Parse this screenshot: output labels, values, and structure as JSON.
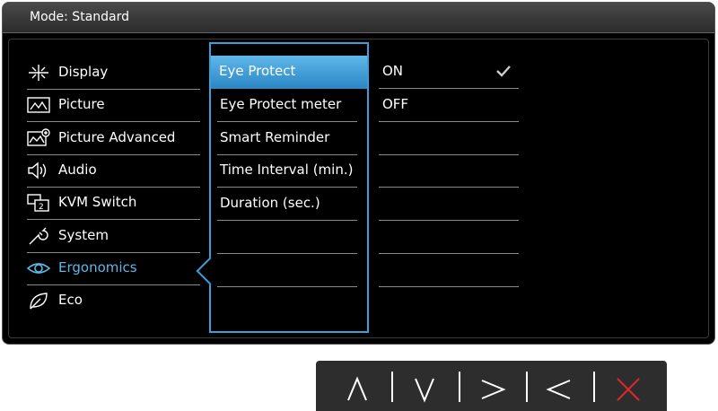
{
  "header": {
    "mode_label": "Mode: Standard"
  },
  "menu": [
    {
      "label": "Display",
      "icon": "display-icon"
    },
    {
      "label": "Picture",
      "icon": "picture-icon"
    },
    {
      "label": "Picture Advanced",
      "icon": "picture-advanced-icon"
    },
    {
      "label": "Audio",
      "icon": "audio-icon"
    },
    {
      "label": "KVM Switch",
      "icon": "kvm-switch-icon"
    },
    {
      "label": "System",
      "icon": "system-icon"
    },
    {
      "label": "Ergonomics",
      "icon": "ergonomics-icon",
      "active": true
    },
    {
      "label": "Eco",
      "icon": "eco-icon"
    }
  ],
  "submenu": [
    {
      "label": "Eye Protect",
      "selected": true
    },
    {
      "label": "Eye Protect meter"
    },
    {
      "label": "Smart Reminder"
    },
    {
      "label": "Time Interval (min.)"
    },
    {
      "label": "Duration (sec.)"
    }
  ],
  "options": [
    {
      "label": "ON",
      "checked": true
    },
    {
      "label": "OFF"
    }
  ],
  "controls": [
    {
      "name": "up-button",
      "icon": "chevron-up-icon"
    },
    {
      "name": "down-button",
      "icon": "chevron-down-icon"
    },
    {
      "name": "right-button",
      "icon": "chevron-right-icon"
    },
    {
      "name": "left-button",
      "icon": "chevron-left-icon"
    },
    {
      "name": "close-button",
      "icon": "close-icon"
    }
  ],
  "colors": {
    "accent": "#3aa0dc",
    "active_text": "#5bb8e6",
    "close": "#e0252c",
    "osd_bg": "#000000",
    "control_bar": "#2d2d2d"
  }
}
